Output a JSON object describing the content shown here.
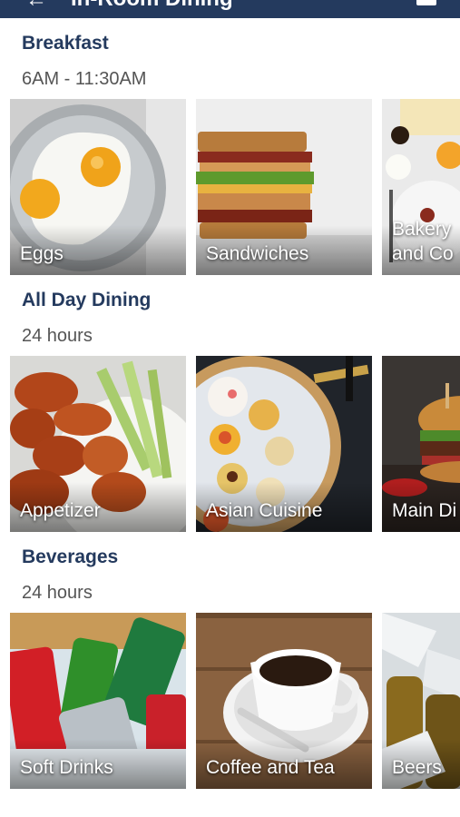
{
  "header": {
    "title": "In-Room Dining",
    "back_icon": "back-arrow-icon",
    "cart_icon": "cart-icon",
    "background": "#243a5e"
  },
  "sections": [
    {
      "title": "Breakfast",
      "hours": "6AM - 11:30AM",
      "items": [
        {
          "label": "Eggs",
          "image": "fried-eggs"
        },
        {
          "label": "Sandwiches",
          "image": "club-sandwich"
        },
        {
          "label": "Bakery\nand Co",
          "image": "bakery-breakfast"
        }
      ]
    },
    {
      "title": "All Day Dining",
      "hours": "24 hours",
      "items": [
        {
          "label": "Appetizer",
          "image": "chicken-wings"
        },
        {
          "label": "Asian Cuisine",
          "image": "dim-sum"
        },
        {
          "label": "Main Di",
          "image": "burger"
        }
      ]
    },
    {
      "title": "Beverages",
      "hours": "24 hours",
      "items": [
        {
          "label": "Soft Drinks",
          "image": "soda-cans"
        },
        {
          "label": "Coffee and Tea",
          "image": "coffee-cup"
        },
        {
          "label": "Beers",
          "image": "beer-bottles-ice"
        }
      ]
    }
  ],
  "colors": {
    "section_title": "#243a5e",
    "hours_text": "#555555"
  }
}
